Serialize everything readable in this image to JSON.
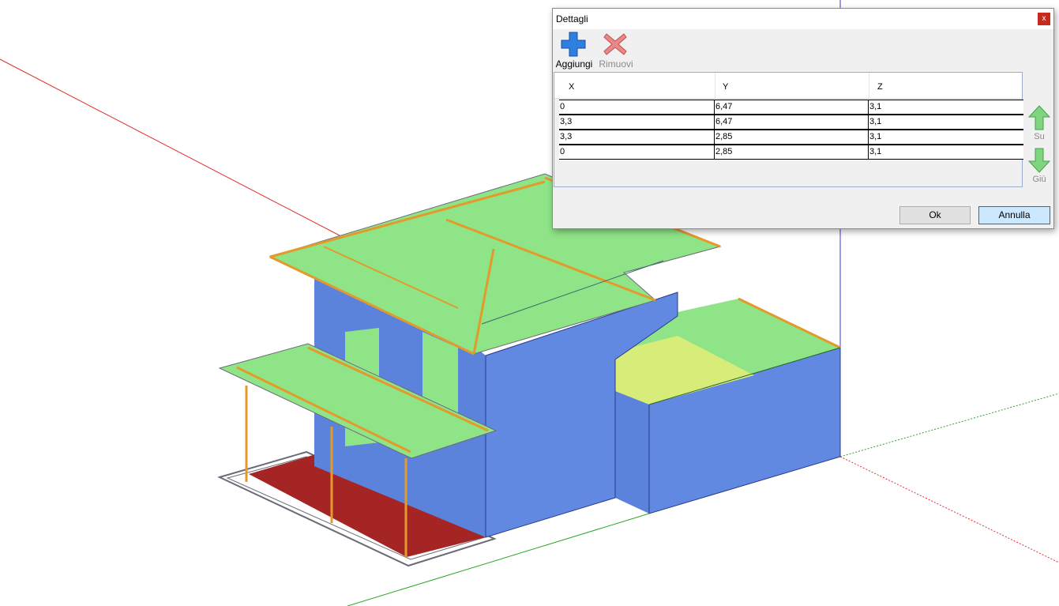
{
  "dialog": {
    "title": "Dettagli",
    "close_label": "x",
    "toolbar": {
      "add_label": "Aggiungi",
      "remove_label": "Rimuovi"
    },
    "columns": [
      "X",
      "Y",
      "Z"
    ],
    "rows": [
      [
        "0",
        "6,47",
        "3,1"
      ],
      [
        "3,3",
        "6,47",
        "3,1"
      ],
      [
        "3,3",
        "2,85",
        "3,1"
      ],
      [
        "0",
        "2,85",
        "3,1"
      ]
    ],
    "move_up_label": "Su",
    "move_down_label": "Giù",
    "ok_label": "Ok",
    "cancel_label": "Annulla"
  },
  "colors": {
    "wall": "#6289e2",
    "roof": "#8ee487",
    "beam": "#e39a2b",
    "floor": "#a52525",
    "axis_red": "#e03030",
    "axis_green": "#2aa52a",
    "axis_blue": "#3a3ad8",
    "add_icon": "#2d7fe0",
    "remove_icon": "#e05a5a",
    "arrow_icon": "#6bd26b"
  }
}
